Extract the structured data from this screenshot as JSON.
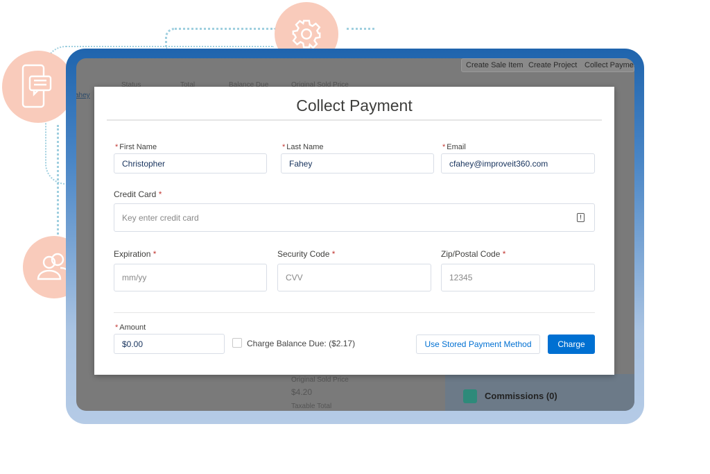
{
  "background": {
    "actions": [
      "Create Sale Item",
      "Create Project",
      "Collect Payment"
    ],
    "columns": [
      "Status",
      "Total",
      "Balance Due",
      "Original Sold Price"
    ],
    "link": "ahey",
    "original_sold_price_label": "Original Sold Price",
    "original_sold_price_value": "$4.20",
    "taxable_total_label": "Taxable Total",
    "commissions": "Commissions (0)"
  },
  "modal": {
    "title": "Collect Payment",
    "first_name": {
      "label": "First Name",
      "value": "Christopher"
    },
    "last_name": {
      "label": "Last Name",
      "value": "Fahey"
    },
    "email": {
      "label": "Email",
      "value": "cfahey@improveit360.com"
    },
    "credit_card": {
      "label": "Credit Card",
      "placeholder": "Key enter credit card"
    },
    "expiration": {
      "label": "Expiration",
      "placeholder": "mm/yy"
    },
    "security_code": {
      "label": "Security Code",
      "placeholder": "CVV"
    },
    "zip": {
      "label": "Zip/Postal Code",
      "placeholder": "12345"
    },
    "amount": {
      "label": "Amount",
      "value": "$0.00"
    },
    "charge_balance": {
      "label": "Charge Balance Due: ($2.17)",
      "checked": false
    },
    "stored_button": "Use Stored Payment Method",
    "charge_button": "Charge",
    "required_mark": "*"
  },
  "colors": {
    "accent": "#0070d2",
    "required": "#c23934",
    "decor": "#f9cbbb"
  }
}
